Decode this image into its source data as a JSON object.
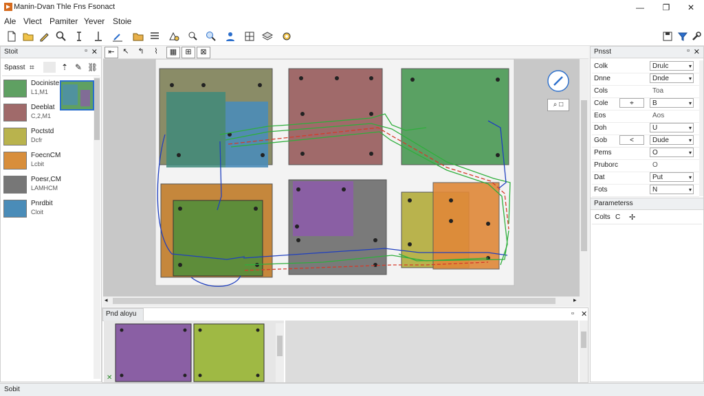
{
  "window": {
    "title": "Manin-Dvan Thle Fns Fsonact",
    "minimize": "—",
    "maximize": "❐",
    "close": "✕"
  },
  "menu": {
    "items": [
      "Ale",
      "Vlect",
      "Pamiter",
      "Yever",
      "Stoie"
    ]
  },
  "toolbar": {
    "icons": [
      "new-file-icon",
      "open-folder-icon",
      "pencil-icon",
      "search-icon",
      "text-cursor-icon",
      "align-icon",
      "edit-icon",
      "folder-icon",
      "list-icon",
      "shapes-icon",
      "zoom-icon",
      "zoom-in-icon",
      "user-icon",
      "grid-icon",
      "layers-icon",
      "settings-icon"
    ],
    "right_icons": [
      "save-icon",
      "filter-icon",
      "wrench-icon"
    ]
  },
  "left_panel": {
    "title": "Stoit",
    "header_label": "Spasst",
    "header_icon": "crop-icon",
    "layers": [
      {
        "name": "Dociniste",
        "sub": "L1,M1",
        "color": "#5fa062"
      },
      {
        "name": "Deeblat",
        "sub": "C,2,M1",
        "color": "#a06a6a"
      },
      {
        "name": "Poctstd",
        "sub": "Dcfr",
        "color": "#b9b34d"
      },
      {
        "name": "FoecnCM",
        "sub": "Lcbit",
        "color": "#d88e3b"
      },
      {
        "name": "Poesr,CM",
        "sub": "LAMHCM",
        "color": "#777777"
      },
      {
        "name": "Pnrdbit",
        "sub": "Cloit",
        "color": "#4a8cb8"
      }
    ]
  },
  "canvas": {
    "tools": [
      "select-tool-icon",
      "arrow-tool-icon",
      "route-tool-icon",
      "line-tool-icon",
      "component-tool-icon",
      "drc-tool-icon",
      "delete-tool-icon"
    ],
    "zoom_button": "⌕ □"
  },
  "bottom_panel": {
    "title": "Pnd aloyu"
  },
  "right_panel": {
    "title": "Pnsst",
    "rows": [
      {
        "label": "Colk",
        "value": "Drulc",
        "type": "select"
      },
      {
        "label": "Dnne",
        "value": "Dnde",
        "type": "select"
      },
      {
        "label": "Cols",
        "value": "Toa",
        "type": "plain"
      },
      {
        "label": "Cole",
        "value": "B",
        "type": "select",
        "step": "⌖"
      },
      {
        "label": "Eos",
        "value": "Aos",
        "type": "plain"
      },
      {
        "label": "Doh",
        "value": "U",
        "type": "select"
      },
      {
        "label": "Gob",
        "value": "Dude",
        "type": "select",
        "step": "<"
      },
      {
        "label": "Pems",
        "value": "O",
        "type": "select"
      },
      {
        "label": "Pruborc",
        "value": "O",
        "type": "plain"
      },
      {
        "label": "Dat",
        "value": "Put",
        "type": "select"
      },
      {
        "label": "Fots",
        "value": "N",
        "type": "select"
      }
    ],
    "section": "Parameterss",
    "colts_label": "Colts",
    "colts_value": "C"
  },
  "statusbar": {
    "text": "Sobit"
  },
  "colors": {
    "accent": "#2a6ecc",
    "route_blue": "#1f3fbf",
    "route_green": "#2fae3c",
    "route_red": "#d43a2a"
  }
}
